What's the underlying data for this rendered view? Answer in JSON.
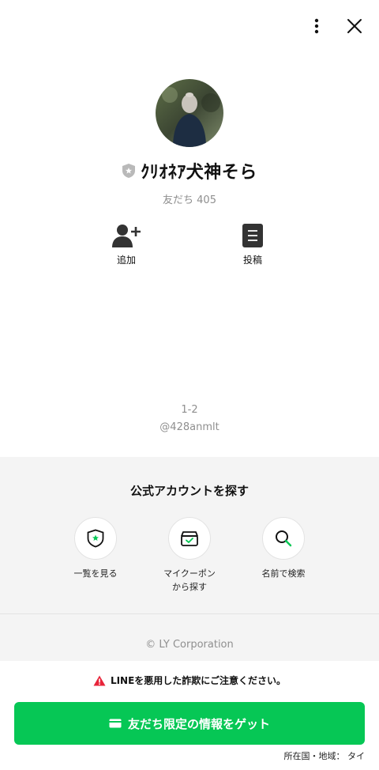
{
  "header": {
    "menu_icon": "vertical-ellipsis-icon",
    "close_icon": "close-icon"
  },
  "profile": {
    "name": "ｸﾘｵﾈｱ犬神そら",
    "badge_icon": "shield-star-icon",
    "friends_count": "友だち 405"
  },
  "actions": [
    {
      "label": "追加",
      "icon": "add-friend-icon"
    },
    {
      "label": "投稿",
      "icon": "post-icon"
    }
  ],
  "meta": {
    "line1": "1-2",
    "line2": "@428anmlt"
  },
  "explore": {
    "title": "公式アカウントを探す",
    "items": [
      {
        "label": "一覧を見る",
        "icon": "shield-star-icon"
      },
      {
        "label": "マイクーポン\nから探す",
        "icon": "coupon-box-icon"
      },
      {
        "label": "名前で検索",
        "icon": "search-icon"
      }
    ],
    "copyright": "© LY Corporation"
  },
  "footer": {
    "warning": "LINEを悪用した詐欺にご注意ください。",
    "cta_label": "友だち限定の情報をゲット",
    "region": "所在国・地域： タイ"
  },
  "colors": {
    "accent": "#06c755",
    "gray_bg": "#f4f4f4",
    "warning": "#e8243a"
  }
}
